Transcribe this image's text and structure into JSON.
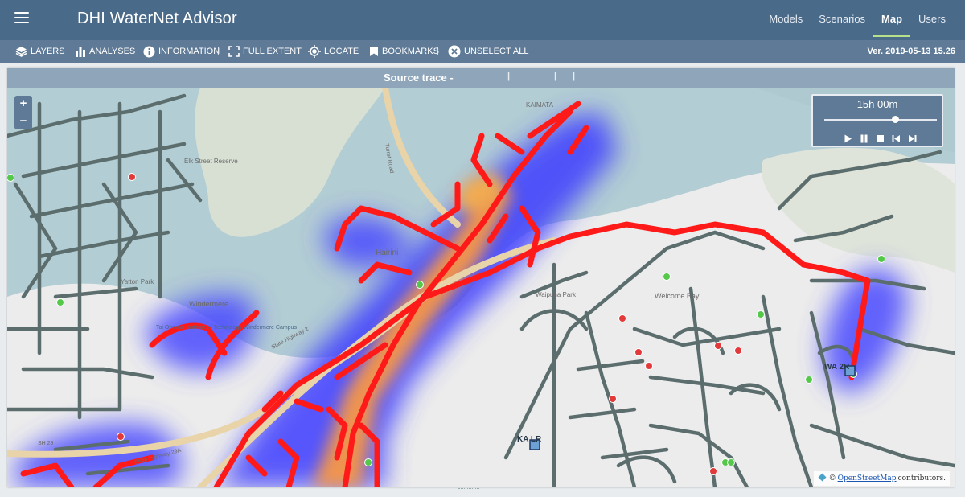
{
  "app": {
    "title": "DHI WaterNet Advisor"
  },
  "nav": [
    {
      "label": "Models"
    },
    {
      "label": "Scenarios"
    },
    {
      "label": "Map"
    },
    {
      "label": "Users"
    }
  ],
  "toolbar": {
    "layers": "LAYERS",
    "analyses": "ANALYSES",
    "information": "INFORMATION",
    "full_extent": "FULL EXTENT",
    "locate": "LOCATE",
    "bookmarks": "BOOKMARKS",
    "unselect_all": "UNSELECT ALL",
    "separator": "|",
    "version": "Ver. 2019-05-13 15.26"
  },
  "panel": {
    "title": "Source trace -",
    "separator": "|"
  },
  "map": {
    "zoom_in": "+",
    "zoom_out": "−",
    "labels": {
      "kaimata": "KAIMATA",
      "hairini": "Hairini",
      "yatton_park": "Yatton Park",
      "elk_street_reserve": "Elk Street Reserve",
      "waipuna_park": "Waipuna Park",
      "welcome_bay": "Welcome Bay",
      "windermere": "Windermere",
      "tot_institute": "Toi Ohomai Institute of Technology Windermere Campus",
      "ka_lr": "KA  LR",
      "wa_lr": "WA    2R",
      "sh29": "SH 29",
      "state_highway_29a": "State Highway 29A",
      "state_highway_2": "State Highway 2",
      "turret_road": "Turret Road"
    }
  },
  "player": {
    "time": "15h 00m",
    "progress": 0.63
  },
  "attribution": {
    "copyright": "©",
    "link": "OpenStreetMap",
    "suffix": "contributors."
  },
  "colors": {
    "header": "#4a6a8a",
    "toolbar": "#5e7a96",
    "panel_head": "#8fa5ba",
    "trace": "#ff1a1a",
    "pipe": "#5a6b6b",
    "active_tab": "#b7e08a"
  }
}
